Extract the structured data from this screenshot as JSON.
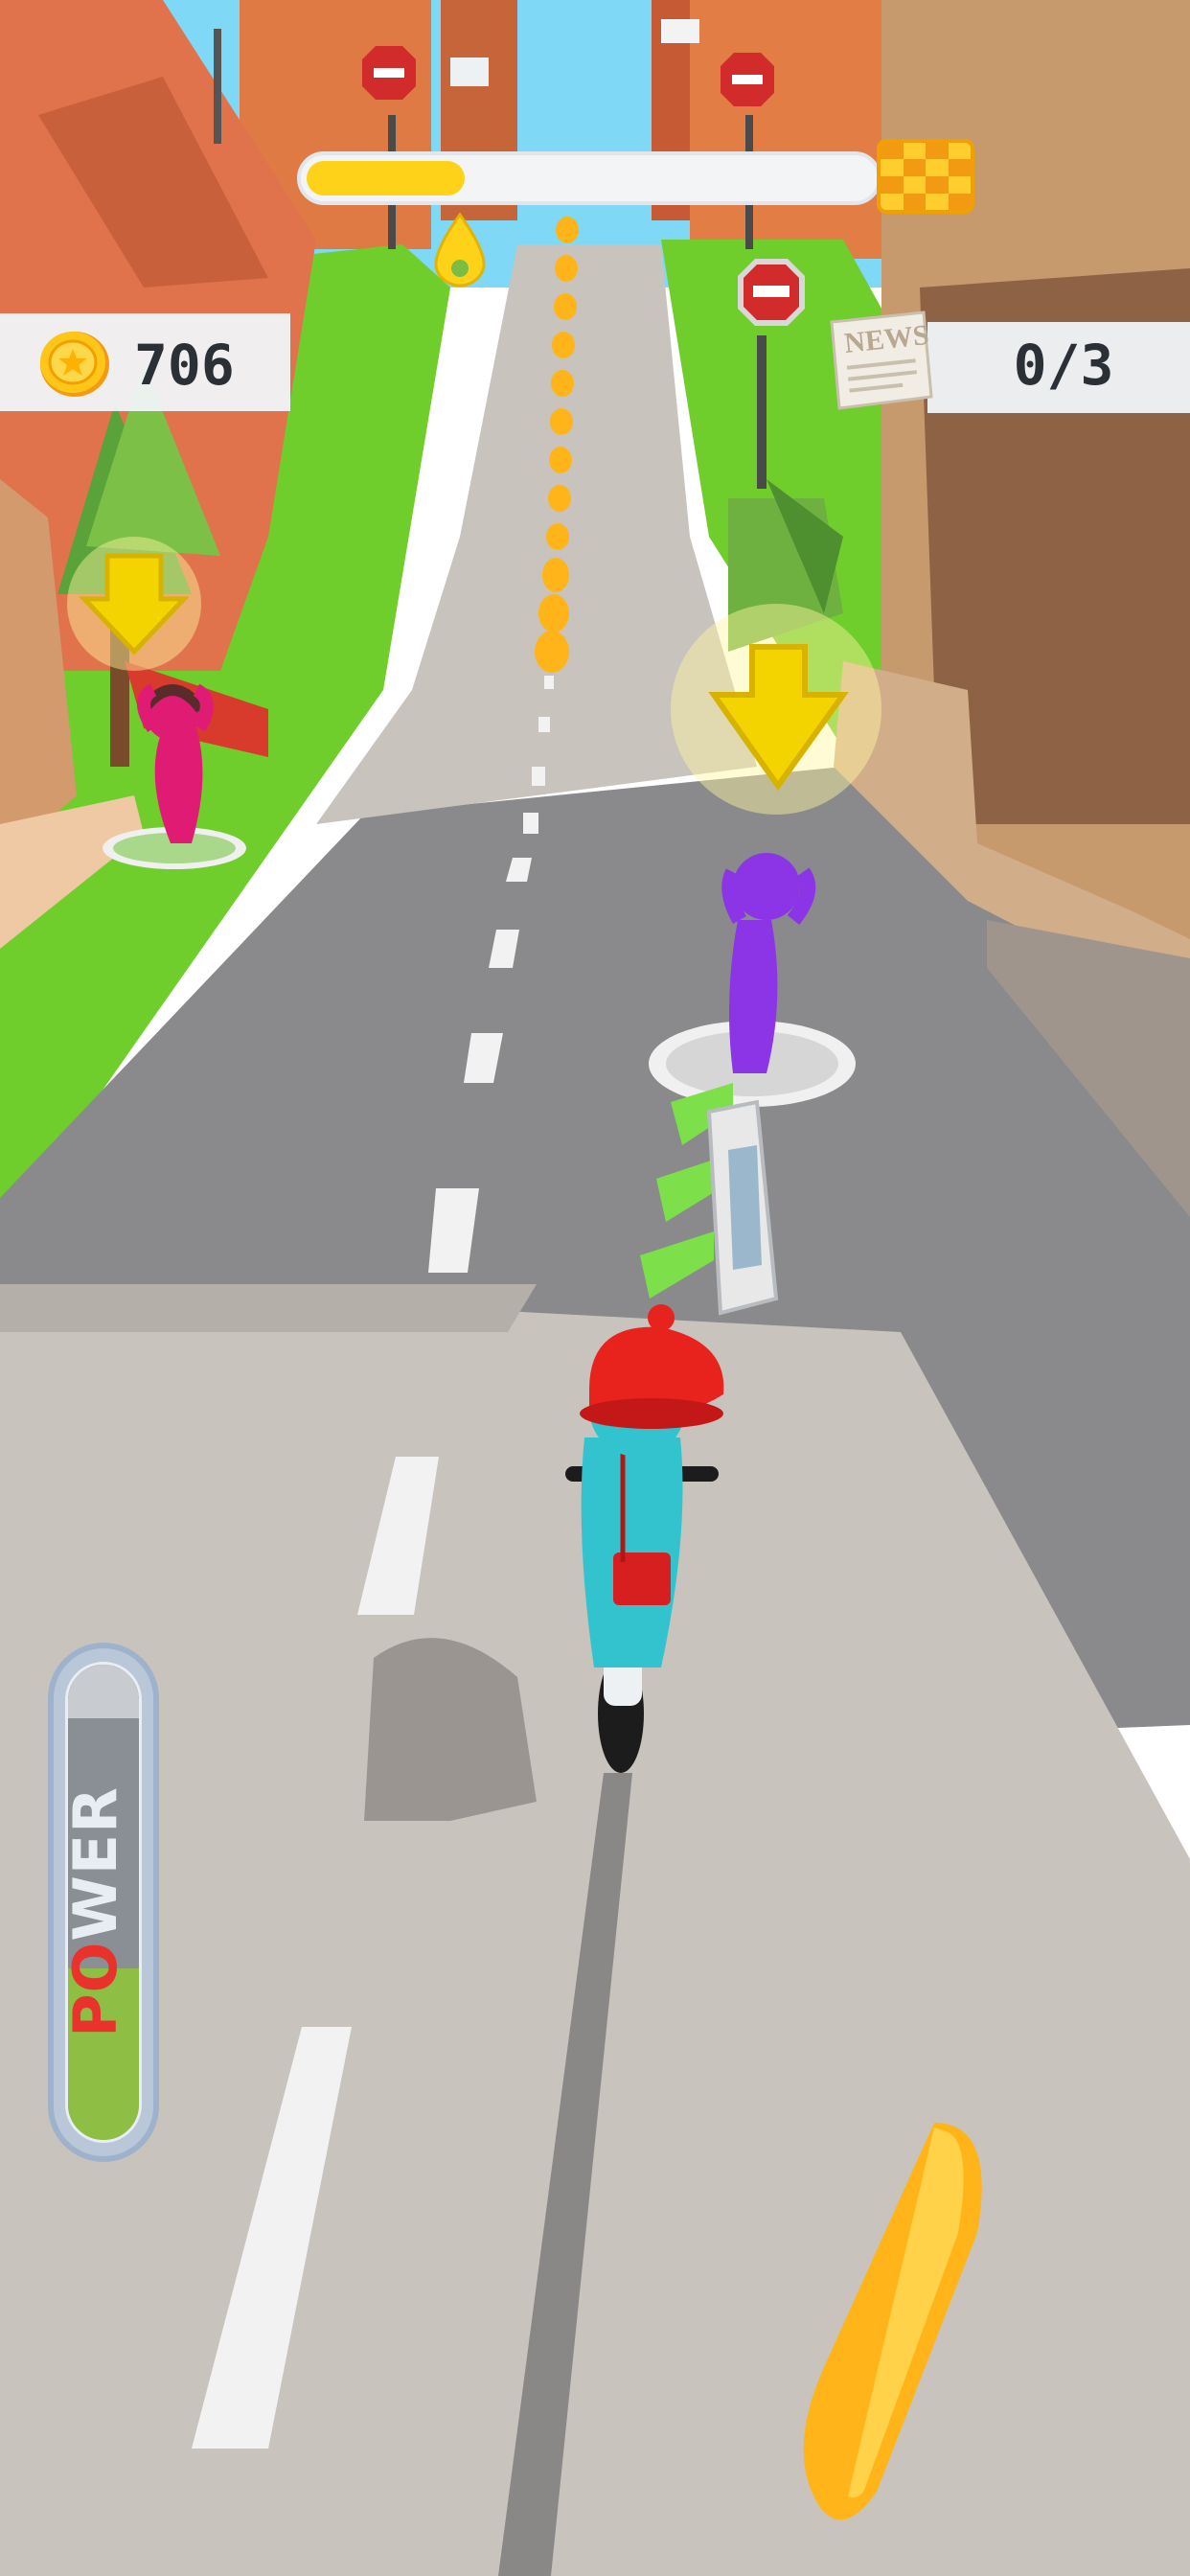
{
  "hud": {
    "coins": "706",
    "news_delivered": "0/3",
    "news_icon_text": "NEWS",
    "power_label": "POWER",
    "power_level": 0.36,
    "level_progress": 0.28
  },
  "colors": {
    "coin_gold": "#ffc61a",
    "progress_fill": "#ffd21a",
    "power_fill": "#8fbe45",
    "power_label_red": "#e8322b",
    "grass": "#6fcd2c",
    "road": "#c9c3bd",
    "rider_body": "#33c3cf",
    "helmet": "#e8231d",
    "customer_left": "#e01b74",
    "customer_right": "#8c35e6",
    "target_arrow": "#f4d400"
  },
  "icons": [
    "coin-icon",
    "newspaper-icon",
    "finish-flag-icon",
    "player-marker-icon",
    "target-arrow-icon"
  ]
}
